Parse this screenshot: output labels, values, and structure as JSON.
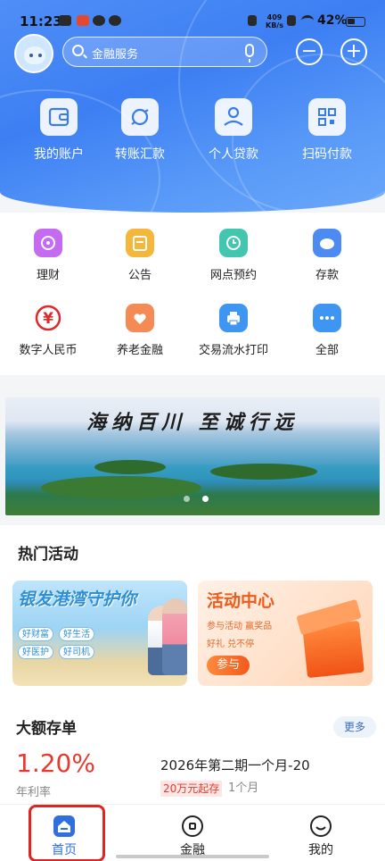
{
  "status_bar": {
    "time": "11:23",
    "network_speed_value": "409",
    "network_speed_unit": "KB/s",
    "battery": "42%"
  },
  "header": {
    "search_placeholder": "金融服务",
    "minus_symbol": "−",
    "plus_symbol": "+",
    "nav": [
      {
        "label": "我的账户",
        "icon": "wallet-icon"
      },
      {
        "label": "转账汇款",
        "icon": "transfer-icon"
      },
      {
        "label": "个人贷款",
        "icon": "loan-icon"
      },
      {
        "label": "扫码付款",
        "icon": "qr-code-icon"
      }
    ]
  },
  "quick_grid": [
    {
      "label": "理财",
      "icon": "wealth-icon",
      "color": "#c46bf0"
    },
    {
      "label": "公告",
      "icon": "notice-icon",
      "color": "#f5b73b"
    },
    {
      "label": "网点预约",
      "icon": "clock-icon",
      "color": "#43c6b0"
    },
    {
      "label": "存款",
      "icon": "piggy-bank-icon",
      "color": "#4c8bf2"
    },
    {
      "label": "数字人民币",
      "icon": "yuan-icon",
      "color": "#e02a2a"
    },
    {
      "label": "养老金融",
      "icon": "heart-icon",
      "color": "#f48a54"
    },
    {
      "label": "交易流水打印",
      "icon": "printer-icon",
      "color": "#3f95f2"
    },
    {
      "label": "全部",
      "icon": "more-icon",
      "color": "#3f95f2"
    }
  ],
  "banner": {
    "slogan": "海纳百川 至诚行远",
    "slide_count": 2,
    "active_slide": 2
  },
  "hot_activities": {
    "title": "热门活动",
    "card1": {
      "title": "银发港湾守护你",
      "tags": [
        "好财富",
        "好生活",
        "好医护",
        "好司机"
      ]
    },
    "card2": {
      "title": "活动中心",
      "subtitle": "参与活动 赢奖品",
      "subtitle2": "好礼 兑不停",
      "cta": "参与"
    }
  },
  "deposit": {
    "title": "大额存单",
    "more": "更多",
    "rate": "1.20%",
    "rate_label": "年利率",
    "product_name": "2026年第二期一个月-20",
    "min_amount": "20万元起存",
    "term": "1个月"
  },
  "bottom_nav": [
    {
      "label": "首页",
      "icon": "home-icon",
      "active": true
    },
    {
      "label": "金融",
      "icon": "finance-icon",
      "active": false
    },
    {
      "label": "我的",
      "icon": "profile-icon",
      "active": false
    }
  ],
  "colors": {
    "brand_blue": "#3d7ff3",
    "accent_red": "#e63a2e",
    "highlight_frame": "#e0241f"
  }
}
